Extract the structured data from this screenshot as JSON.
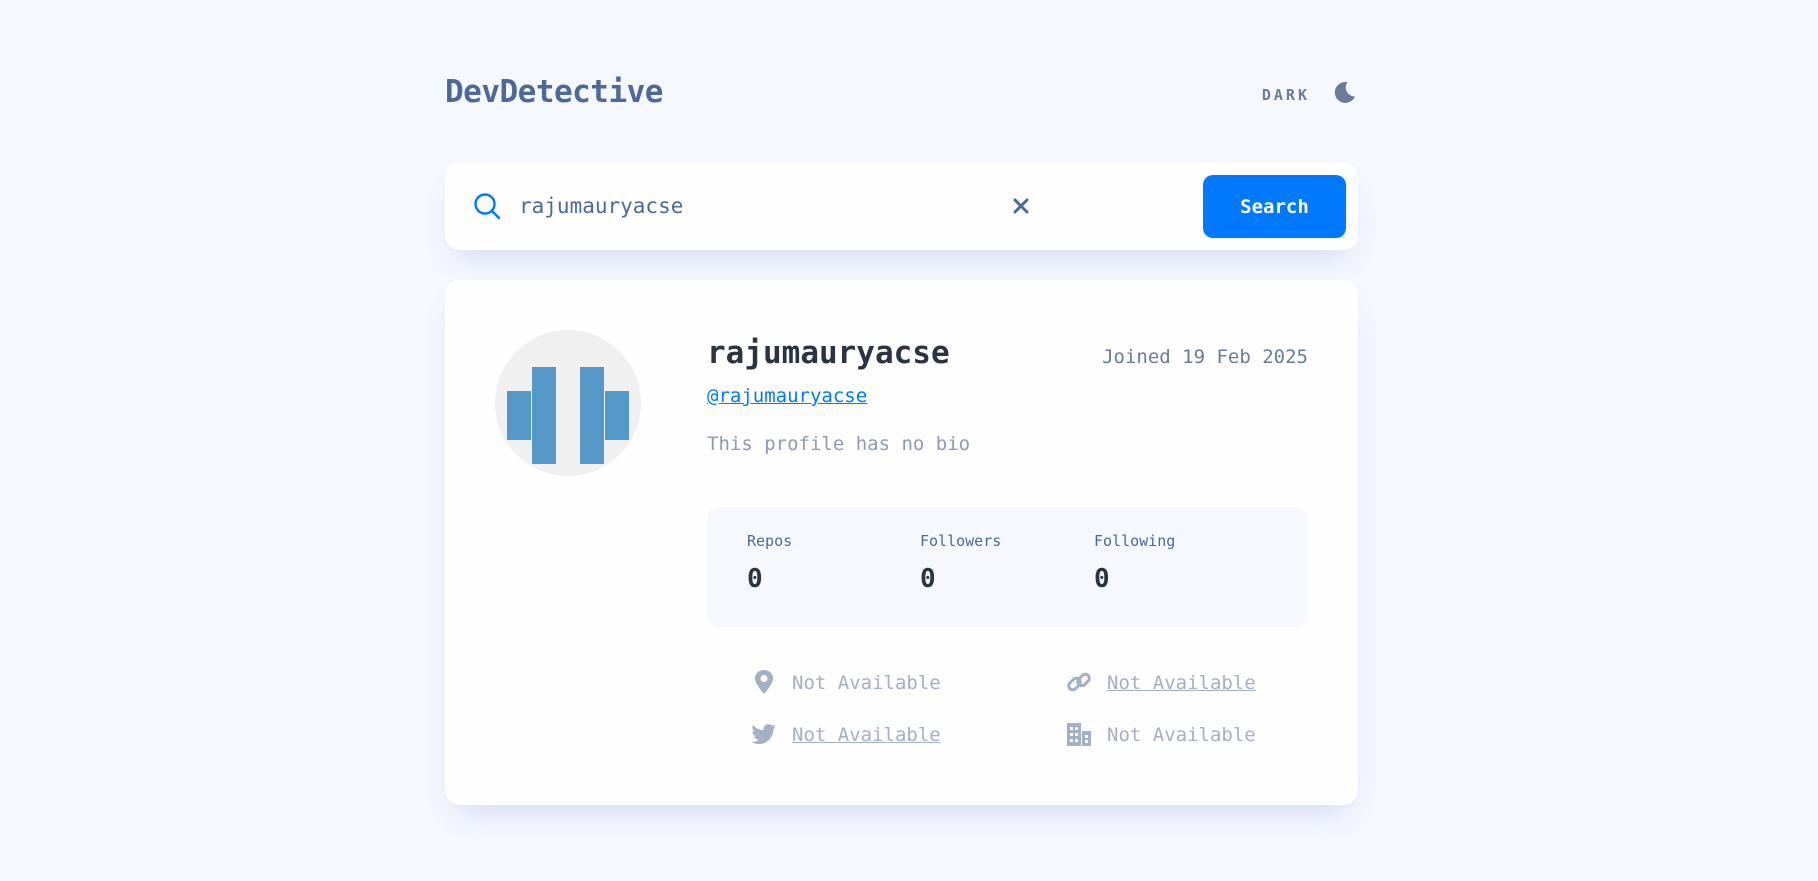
{
  "app": {
    "title": "DevDetective",
    "theme_label": "DARK",
    "theme_icon": "moon-icon"
  },
  "search": {
    "value": "rajumauryacse",
    "placeholder": "",
    "button_label": "Search"
  },
  "profile": {
    "name": "rajumauryacse",
    "joined": "Joined 19 Feb 2025",
    "handle": "@rajumauryacse",
    "bio": "This profile has no bio",
    "stats": [
      {
        "label": "Repos",
        "value": "0"
      },
      {
        "label": "Followers",
        "value": "0"
      },
      {
        "label": "Following",
        "value": "0"
      }
    ],
    "info": {
      "location": {
        "icon": "location-pin-icon",
        "text": "Not Available"
      },
      "website": {
        "icon": "link-icon",
        "text": "Not Available"
      },
      "twitter": {
        "icon": "twitter-icon",
        "text": "Not Available"
      },
      "company": {
        "icon": "building-icon",
        "text": "Not Available"
      }
    }
  },
  "colors": {
    "accent": "#0079ff",
    "background": "#f5f8ff",
    "card": "#fefefe",
    "heading": "#2b3442",
    "muted": "#4b6a9b",
    "disabled": "#a3b0c5",
    "avatar_identicon": "#5599c9"
  }
}
